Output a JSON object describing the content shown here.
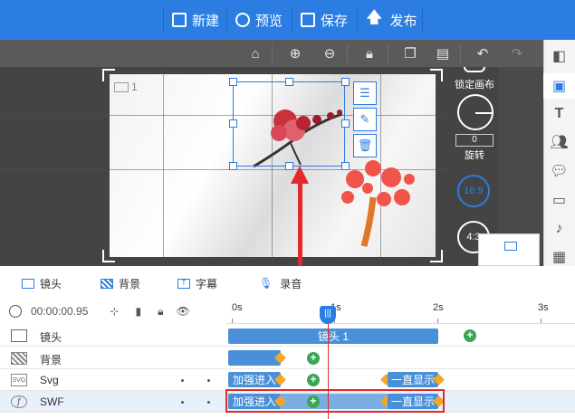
{
  "topbar": {
    "new_label": "新建",
    "preview_label": "预览",
    "save_label": "保存",
    "publish_label": "发布"
  },
  "canvas": {
    "camera_number": "1"
  },
  "right_panel": {
    "lock_canvas_label": "锁定画布",
    "rotate_value": "0",
    "rotate_label": "旋转",
    "ratio_16_9": "16:9",
    "ratio_4_3": "4:3"
  },
  "tabs": {
    "camera": "镜头",
    "background": "背景",
    "subtitle": "字幕",
    "record": "录音"
  },
  "timeline": {
    "time_display": "00:00:00.95",
    "ticks": [
      "0s",
      "1s",
      "2s",
      "3s"
    ],
    "playhead_marker": "|||"
  },
  "tracks": [
    {
      "name": "镜头",
      "icon_text": "",
      "clips": [
        "镜头 1"
      ]
    },
    {
      "name": "背景",
      "icon_text": "",
      "clips": []
    },
    {
      "name": "Svg",
      "icon_text": "SVG",
      "clips": [
        "加强进入",
        "一直显示"
      ]
    },
    {
      "name": "SWF",
      "icon_text": "ƒ",
      "clips": [
        "加强进入",
        "一直显示"
      ]
    }
  ],
  "colors": {
    "accent": "#2b7de1",
    "highlight": "#e02b2b",
    "clip": "#4a90d9",
    "keyframe": "#f5a623",
    "add": "#3aa655"
  }
}
